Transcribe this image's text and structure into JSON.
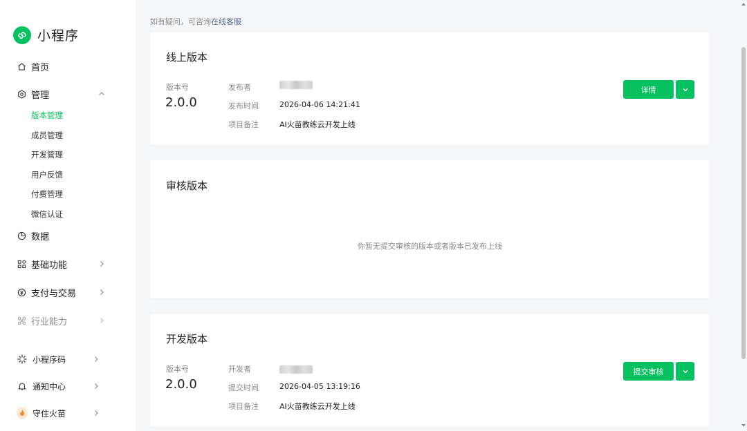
{
  "brand": {
    "name": "小程序",
    "color": "#07c160"
  },
  "nav": {
    "home": "首页",
    "manage": "管理",
    "manage_sub": [
      "版本管理",
      "成员管理",
      "开发管理",
      "用户反馈",
      "付费管理",
      "微信认证"
    ],
    "data": "数据",
    "basic": "基础功能",
    "pay": "支付与交易",
    "industry": "行业能力"
  },
  "bottom": {
    "qrcode": "小程序码",
    "notify": "通知中心",
    "account": "守住火苗"
  },
  "tip": {
    "text": "如有疑问，可咨询",
    "link": "在线客服"
  },
  "online": {
    "title": "线上版本",
    "version_label": "版本号",
    "version": "2.0.0",
    "publisher_key": "发布者",
    "time_key": "发布时间",
    "time_val": "2026-04-06 14:21:41",
    "note_key": "项目备注",
    "note_val": "AI火苗教练云开发上线",
    "detail_btn": "详情"
  },
  "review": {
    "title": "审核版本",
    "empty": "你暂无提交审核的版本或者版本已发布上线"
  },
  "dev": {
    "title": "开发版本",
    "version_label": "版本号",
    "version": "2.0.0",
    "developer_key": "开发者",
    "time_key": "提交时间",
    "time_val": "2026-04-05 13:19:16",
    "note_key": "项目备注",
    "note_val": "AI火苗教练云开发上线",
    "submit_btn": "提交审核"
  },
  "icons": {
    "home": "home-icon",
    "manage": "gear-icon",
    "data": "pie-chart-icon",
    "basic": "grid-icon",
    "pay": "yen-icon",
    "industry": "nodes-icon",
    "qrcode": "qrcode-icon",
    "notify": "bell-icon",
    "account": "flame-avatar"
  }
}
